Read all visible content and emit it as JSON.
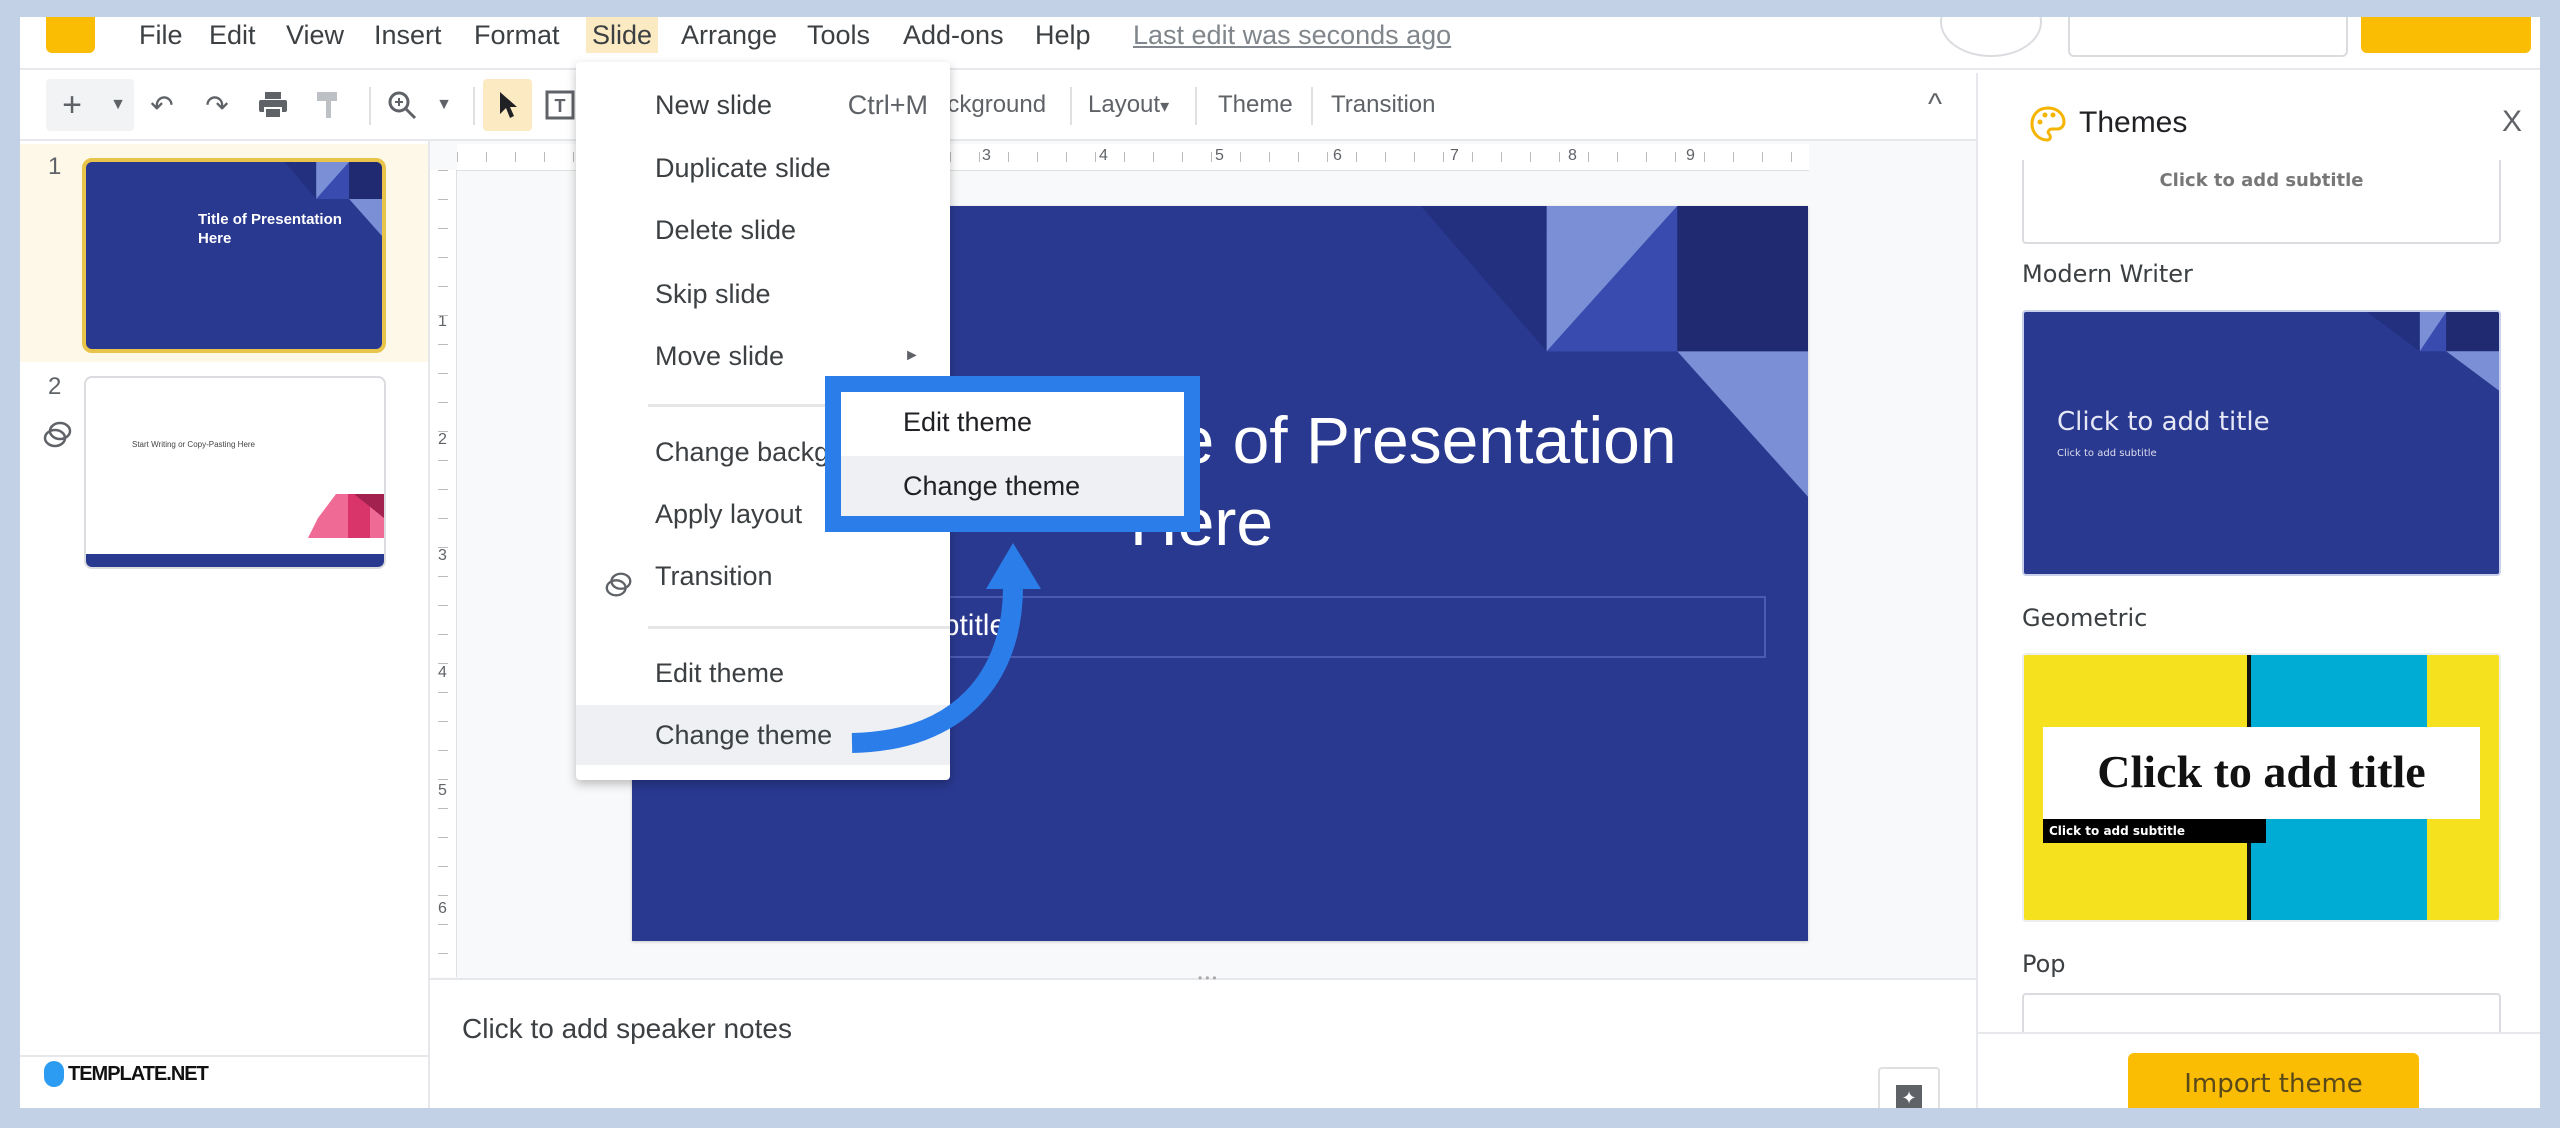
{
  "menubar": {
    "items": [
      "File",
      "Edit",
      "View",
      "Insert",
      "Format",
      "Slide",
      "Arrange",
      "Tools",
      "Add-ons",
      "Help"
    ],
    "active": "Slide",
    "last_edit": "Last edit was seconds ago"
  },
  "toolbar": {
    "icons": [
      "plus-icon",
      "dropdown-icon",
      "undo-icon",
      "redo-icon",
      "print-icon",
      "paint-format-icon",
      "zoom-icon",
      "dropdown-icon",
      "select-cursor-icon",
      "text-box-icon",
      "collapse-icon"
    ],
    "background": "Background",
    "layout": "Layout",
    "layout_caret": "▾",
    "theme": "Theme",
    "transition": "Transition",
    "collapse": "^"
  },
  "ruler": {
    "top": [
      "3",
      "4",
      "5",
      "6",
      "7",
      "8",
      "9"
    ],
    "left": [
      "1",
      "2",
      "3",
      "4",
      "5",
      "6"
    ]
  },
  "filmstrip": {
    "slides": [
      {
        "number": "1",
        "title": "Title of Presentation Here",
        "selected": true
      },
      {
        "number": "2",
        "text": "Start Writing or Copy-Pasting Here",
        "has_transition": true
      }
    ]
  },
  "slide": {
    "title_line1": "Title of Presentation",
    "title_line2": "Here",
    "subtitle": "Click to add subtitle"
  },
  "slide_menu": {
    "items": [
      {
        "label": "New slide",
        "shortcut": "Ctrl+M"
      },
      {
        "label": "Duplicate slide"
      },
      {
        "label": "Delete slide"
      },
      {
        "label": "Skip slide"
      },
      {
        "label": "Move slide",
        "submenu": "►"
      },
      {
        "label": "Change background"
      },
      {
        "label": "Apply layout"
      },
      {
        "label": "Transition"
      },
      {
        "label": "Edit theme"
      },
      {
        "label": "Change theme",
        "highlighted": true
      }
    ]
  },
  "callout": {
    "items": [
      "Edit theme",
      "Change theme"
    ],
    "highlighted": "Change theme"
  },
  "notes": {
    "placeholder": "Click to add speaker notes"
  },
  "themes_panel": {
    "title": "Themes",
    "close": "X",
    "themes": [
      {
        "name": "",
        "subtitle": "Click to add subtitle"
      },
      {
        "name": "Modern Writer",
        "title": "Click to add title",
        "subtitle": "Click to add subtitle"
      },
      {
        "name": "Geometric",
        "title": "Click to add title",
        "subtitle": "Click to add subtitle"
      },
      {
        "name": "Pop"
      }
    ],
    "import_button": "Import theme"
  },
  "watermark": "TEMPLATE.NET",
  "colors": {
    "frame": "#c2d1e6",
    "slide_navy": "#2a3990",
    "callout_blue": "#2b7de9",
    "accent_yellow": "#fbbc04",
    "menu_active": "#fbeac2",
    "geometric_yellow": "#f5e11e",
    "geometric_cyan": "#00acd3"
  }
}
